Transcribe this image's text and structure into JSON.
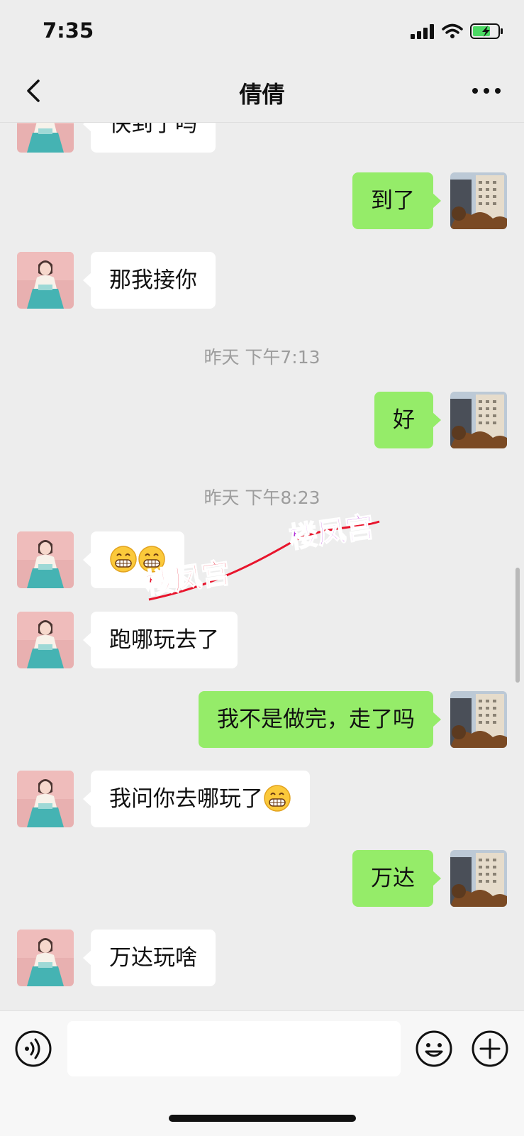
{
  "status_bar": {
    "time": "7:35"
  },
  "header": {
    "title": "倩倩"
  },
  "messages": [
    {
      "side": "left",
      "text": "快到了吗"
    },
    {
      "side": "right",
      "text": "到了"
    },
    {
      "side": "left",
      "text": "那我接你"
    },
    {
      "side": "right",
      "text": "好"
    },
    {
      "side": "left",
      "text": ""
    },
    {
      "side": "left",
      "text": "跑哪玩去了"
    },
    {
      "side": "right",
      "text": "我不是做完，走了吗"
    },
    {
      "side": "left",
      "text": "我问你去哪玩了"
    },
    {
      "side": "right",
      "text": "万达"
    },
    {
      "side": "left",
      "text": "万达玩啥"
    }
  ],
  "timestamps": [
    "昨天 下午7:13",
    "昨天 下午8:23"
  ],
  "watermark": {
    "text1": "楼凤宫",
    "text2": "楼凤宫"
  },
  "input": {
    "value": ""
  },
  "colors": {
    "background": "#ededed",
    "sent_bubble": "#95ec69",
    "received_bubble": "#ffffff",
    "battery": "#4cd964"
  }
}
